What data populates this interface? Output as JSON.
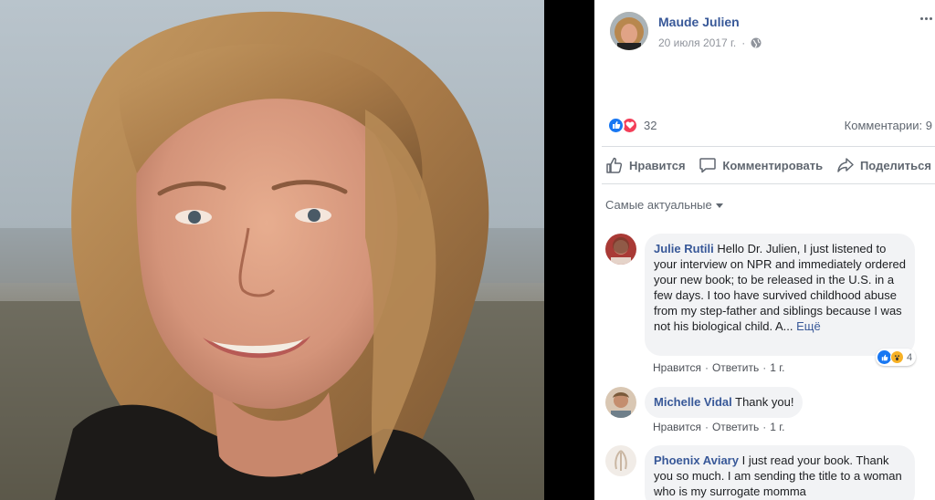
{
  "post": {
    "author": "Maude Julien",
    "date": "20 июля 2017 г.",
    "separator": "·",
    "privacy_icon": "globe-icon",
    "reaction_count": "32",
    "comments_label": "Комментарии: 9"
  },
  "actions": {
    "like": "Нравится",
    "comment": "Комментировать",
    "share": "Поделиться"
  },
  "sort": {
    "label": "Самые актуальные"
  },
  "comments": [
    {
      "author": "Julie Rutili",
      "text": "Hello Dr. Julien, I just listened to your interview on NPR and immediately ordered your new book; to be released in the U.S. in a few days. I too have survived childhood abuse from my step-father and siblings because I was not his biological child. A...",
      "more": "Ещё",
      "like": "Нравится",
      "reply": "Ответить",
      "time": "1 г.",
      "reaction_count": "4"
    },
    {
      "author": "Michelle Vidal",
      "text": "Thank you!",
      "like": "Нравится",
      "reply": "Ответить",
      "time": "1 г."
    },
    {
      "author": "Phoenix Aviary",
      "text": "I just read your book. Thank you so much. I am sending the title to a woman who is my surrogate momma"
    }
  ],
  "colors": {
    "link_blue": "#385898",
    "like_blue": "#1877f2",
    "love_red": "#f33e58",
    "bubble_gray": "#f2f3f5"
  }
}
